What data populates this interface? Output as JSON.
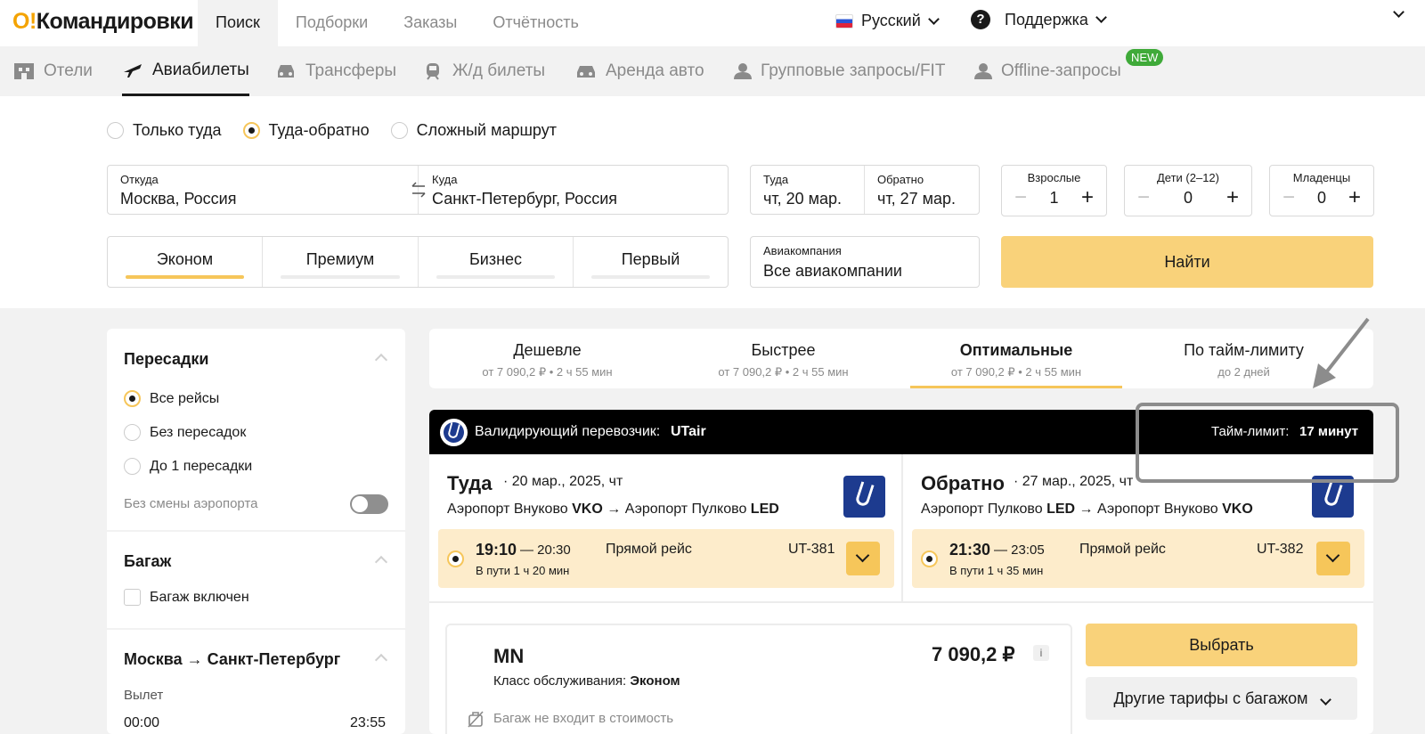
{
  "header": {
    "logo_o": "O!",
    "logo_text": "Командировки",
    "nav": [
      {
        "label": "Поиск"
      },
      {
        "label": "Подборки"
      },
      {
        "label": "Заказы"
      },
      {
        "label": "Отчётность"
      }
    ],
    "language": "Русский",
    "support": "Поддержка",
    "support_icon": "?"
  },
  "products": [
    {
      "label": "Отели",
      "icon": "hotel-icon"
    },
    {
      "label": "Авиабилеты",
      "icon": "plane-icon"
    },
    {
      "label": "Трансферы",
      "icon": "car-icon"
    },
    {
      "label": "Ж/д билеты",
      "icon": "train-icon"
    },
    {
      "label": "Аренда авто",
      "icon": "car-icon"
    },
    {
      "label": "Групповые запросы/FIT",
      "icon": "group-icon"
    },
    {
      "label": "Offline-запросы",
      "icon": "group-icon"
    }
  ],
  "new_badge": "NEW",
  "search": {
    "trip_types": [
      "Только туда",
      "Туда-обратно",
      "Сложный маршрут"
    ],
    "from_label": "Откуда",
    "from_value": "Москва, Россия",
    "to_label": "Куда",
    "to_value": "Санкт-Петербург, Россия",
    "depart_label": "Туда",
    "depart_value": "чт, 20 мар.",
    "return_label": "Обратно",
    "return_value": "чт, 27 мар.",
    "adults_label": "Взрослые",
    "adults_value": "1",
    "children_label": "Дети (2–12)",
    "children_value": "0",
    "infants_label": "Младенцы",
    "infants_value": "0",
    "classes": [
      "Эконом",
      "Премиум",
      "Бизнес",
      "Первый"
    ],
    "airline_label": "Авиакомпания",
    "airline_value": "Все авиакомпании",
    "find_label": "Найти"
  },
  "filters": {
    "transfers_title": "Пересадки",
    "transfers_options": [
      "Все рейсы",
      "Без пересадок",
      "До 1 пересадки"
    ],
    "no_airport_change": "Без смены аэропорта",
    "baggage_title": "Багаж",
    "baggage_option": "Багаж включен",
    "route_title": "Москва → Санкт-Петербург",
    "departure_label": "Вылет",
    "time_from": "00:00",
    "time_to": "23:55"
  },
  "sort_tabs": [
    {
      "title": "Дешевле",
      "sub": "от 7 090,2 ₽ • 2 ч 55 мин"
    },
    {
      "title": "Быстрее",
      "sub": "от 7 090,2 ₽ • 2 ч 55 мин"
    },
    {
      "title": "Оптимальные",
      "sub": "от 7 090,2 ₽ • 2 ч 55 мин"
    },
    {
      "title": "По тайм-лимиту",
      "sub": "до 2 дней"
    }
  ],
  "result": {
    "carrier_prefix": "Валидирующий перевозчик:",
    "carrier": "UTair",
    "time_limit_prefix": "Тайм-лимит:",
    "time_limit": "17 минут",
    "outbound": {
      "title": "Туда",
      "date": "20 мар., 2025, чт",
      "route_from": "Аэропорт Внуково",
      "route_from_code": "VKO",
      "route_to": "Аэропорт Пулково",
      "route_to_code": "LED",
      "dep": "19:10",
      "arr": "— 20:30",
      "duration": "В пути 1 ч 20 мин",
      "type": "Прямой рейс",
      "flight_no": "UT-381"
    },
    "inbound": {
      "title": "Обратно",
      "date": "27 мар., 2025, чт",
      "route_from": "Аэропорт Пулково",
      "route_from_code": "LED",
      "route_to": "Аэропорт Внуково",
      "route_to_code": "VKO",
      "dep": "21:30",
      "arr": "— 23:05",
      "duration": "В пути 1 ч 35 мин",
      "type": "Прямой рейс",
      "flight_no": "UT-382"
    },
    "fare_name": "MN",
    "price": "7 090,2 ₽",
    "info_icon": "i",
    "class_prefix": "Класс обслуживания:",
    "class_value": "Эконом",
    "baggage_note": "Багаж не входит в стоимость",
    "select_label": "Выбрать",
    "other_fares_label": "Другие тарифы с багажом"
  },
  "colors": {
    "accent": "#f6c65a",
    "button": "#f9d27a",
    "flight_bg": "#fdeccb",
    "utair": "#1d3b8f"
  }
}
